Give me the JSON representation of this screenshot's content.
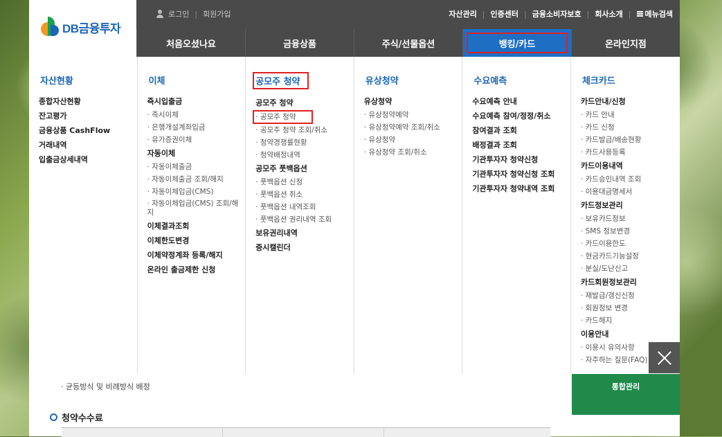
{
  "brand": {
    "name": "DB금융투자"
  },
  "top_links": {
    "login": "로그인",
    "separator": "|",
    "join": "회원가입"
  },
  "utility": [
    {
      "label": "자산관리"
    },
    {
      "label": "인증센터"
    },
    {
      "label": "금융소비자보호"
    },
    {
      "label": "회사소개"
    },
    {
      "label": "메뉴검색",
      "icon": "menu-list-icon"
    }
  ],
  "gnb": [
    {
      "label": "처음오셨나요",
      "active": false
    },
    {
      "label": "금융상품",
      "active": false
    },
    {
      "label": "주식/선물옵션",
      "active": false
    },
    {
      "label": "뱅킹/카드",
      "active": true
    },
    {
      "label": "온라인지점",
      "active": false
    }
  ],
  "columns": [
    {
      "title": "자산현황",
      "items": [
        {
          "type": "link",
          "label": "종합자산현황"
        },
        {
          "type": "link",
          "label": "잔고평가"
        },
        {
          "type": "link",
          "label": "금융상품 CashFlow"
        },
        {
          "type": "link",
          "label": "거래내역"
        },
        {
          "type": "link",
          "label": "입출금상세내역"
        }
      ]
    },
    {
      "title": "이체",
      "items": [
        {
          "type": "link",
          "label": "즉시입출금"
        },
        {
          "type": "sub",
          "label": "· 즉시이체"
        },
        {
          "type": "sub",
          "label": "· 은행개설계좌입금"
        },
        {
          "type": "sub",
          "label": "· 유가증권이체"
        },
        {
          "type": "link",
          "label": "자동이체"
        },
        {
          "type": "sub",
          "label": "· 자동이체출금"
        },
        {
          "type": "sub",
          "label": "· 자동이체출금 조회/해지"
        },
        {
          "type": "sub",
          "label": "· 자동이체입금(CMS)"
        },
        {
          "type": "sub",
          "label": "· 자동이체입금(CMS) 조회/해지",
          "wrap": true
        },
        {
          "type": "link",
          "label": "이체결과조회"
        },
        {
          "type": "link",
          "label": "이체한도변경"
        },
        {
          "type": "link",
          "label": "이체약정계좌 등록/해지"
        },
        {
          "type": "link",
          "label": "온라인 출금제한 신청"
        }
      ]
    },
    {
      "title": "공모주 청약",
      "highlight": true,
      "items": [
        {
          "type": "link",
          "label": "공모주 청약"
        },
        {
          "type": "sub",
          "label": "· 공모주 청약",
          "highlight": true
        },
        {
          "type": "sub",
          "label": "· 공모주 청약 조회/취소"
        },
        {
          "type": "sub",
          "label": "· 청약경쟁률현황"
        },
        {
          "type": "sub",
          "label": "· 청약배정내역"
        },
        {
          "type": "link",
          "label": "공모주 풋백옵션"
        },
        {
          "type": "sub",
          "label": "· 풋백옵션 신청"
        },
        {
          "type": "sub",
          "label": "· 풋백옵션 취소"
        },
        {
          "type": "sub",
          "label": "· 풋백옵션 내역조회"
        },
        {
          "type": "sub",
          "label": "· 풋백옵션 권리내역 조회"
        },
        {
          "type": "link",
          "label": "보유권리내역"
        },
        {
          "type": "link",
          "label": "증시캘린더"
        }
      ]
    },
    {
      "title": "유상청약",
      "items": [
        {
          "type": "link",
          "label": "유상청약"
        },
        {
          "type": "sub",
          "label": "· 유상청약예약"
        },
        {
          "type": "sub",
          "label": "· 유상청약예약 조회/취소"
        },
        {
          "type": "sub",
          "label": "· 유상청약"
        },
        {
          "type": "sub",
          "label": "· 유상청약 조회/취소"
        }
      ]
    },
    {
      "title": "수요예측",
      "items": [
        {
          "type": "link",
          "label": "수요예측 안내"
        },
        {
          "type": "link",
          "label": "수요예측 참여/정정/취소"
        },
        {
          "type": "link",
          "label": "참여결과 조회"
        },
        {
          "type": "link",
          "label": "배정결과 조회"
        },
        {
          "type": "link",
          "label": "기관투자자 청약신청"
        },
        {
          "type": "link",
          "label": "기관투자자 청약신청 조회"
        },
        {
          "type": "link",
          "label": "기관투자자 청약내역 조회"
        }
      ]
    },
    {
      "title": "체크카드",
      "items": [
        {
          "type": "link",
          "label": "카드안내/신청"
        },
        {
          "type": "sub",
          "label": "· 카드 안내"
        },
        {
          "type": "sub",
          "label": "· 카드 신청"
        },
        {
          "type": "sub",
          "label": "· 카드발급/배송현황"
        },
        {
          "type": "sub",
          "label": "· 카드사용등록"
        },
        {
          "type": "link",
          "label": "카드이용내역"
        },
        {
          "type": "sub",
          "label": "· 카드승인내역 조회"
        },
        {
          "type": "sub",
          "label": "· 이용대금명세서"
        },
        {
          "type": "link",
          "label": "카드정보관리"
        },
        {
          "type": "sub",
          "label": "· 보유카드정보"
        },
        {
          "type": "sub",
          "label": "· SMS 정보변경"
        },
        {
          "type": "sub",
          "label": "· 카드이용한도"
        },
        {
          "type": "sub",
          "label": "· 현금카드기능설정"
        },
        {
          "type": "sub",
          "label": "· 분실/도난신고"
        },
        {
          "type": "link",
          "label": "카드회원정보관리"
        },
        {
          "type": "sub",
          "label": "· 재발급/갱신신청"
        },
        {
          "type": "sub",
          "label": "· 회원정보 변경"
        },
        {
          "type": "sub",
          "label": "· 카드해지"
        },
        {
          "type": "link",
          "label": "이용안내"
        },
        {
          "type": "sub",
          "label": "· 이용시 유의사항"
        },
        {
          "type": "sub",
          "label": "· 자주하는 질문(FAQ)"
        }
      ]
    }
  ],
  "below": {
    "bullet": "· 균등방식 및 비례방식 배정",
    "section_title": "청약수수료",
    "green_box": {
      "label": "통합관리"
    }
  },
  "colors": {
    "accent": "#1b66b8",
    "active_tab": "#1e6fc4",
    "highlight": "#e02020",
    "bar": "#4a4a4a",
    "green": "#1f8a4a"
  }
}
